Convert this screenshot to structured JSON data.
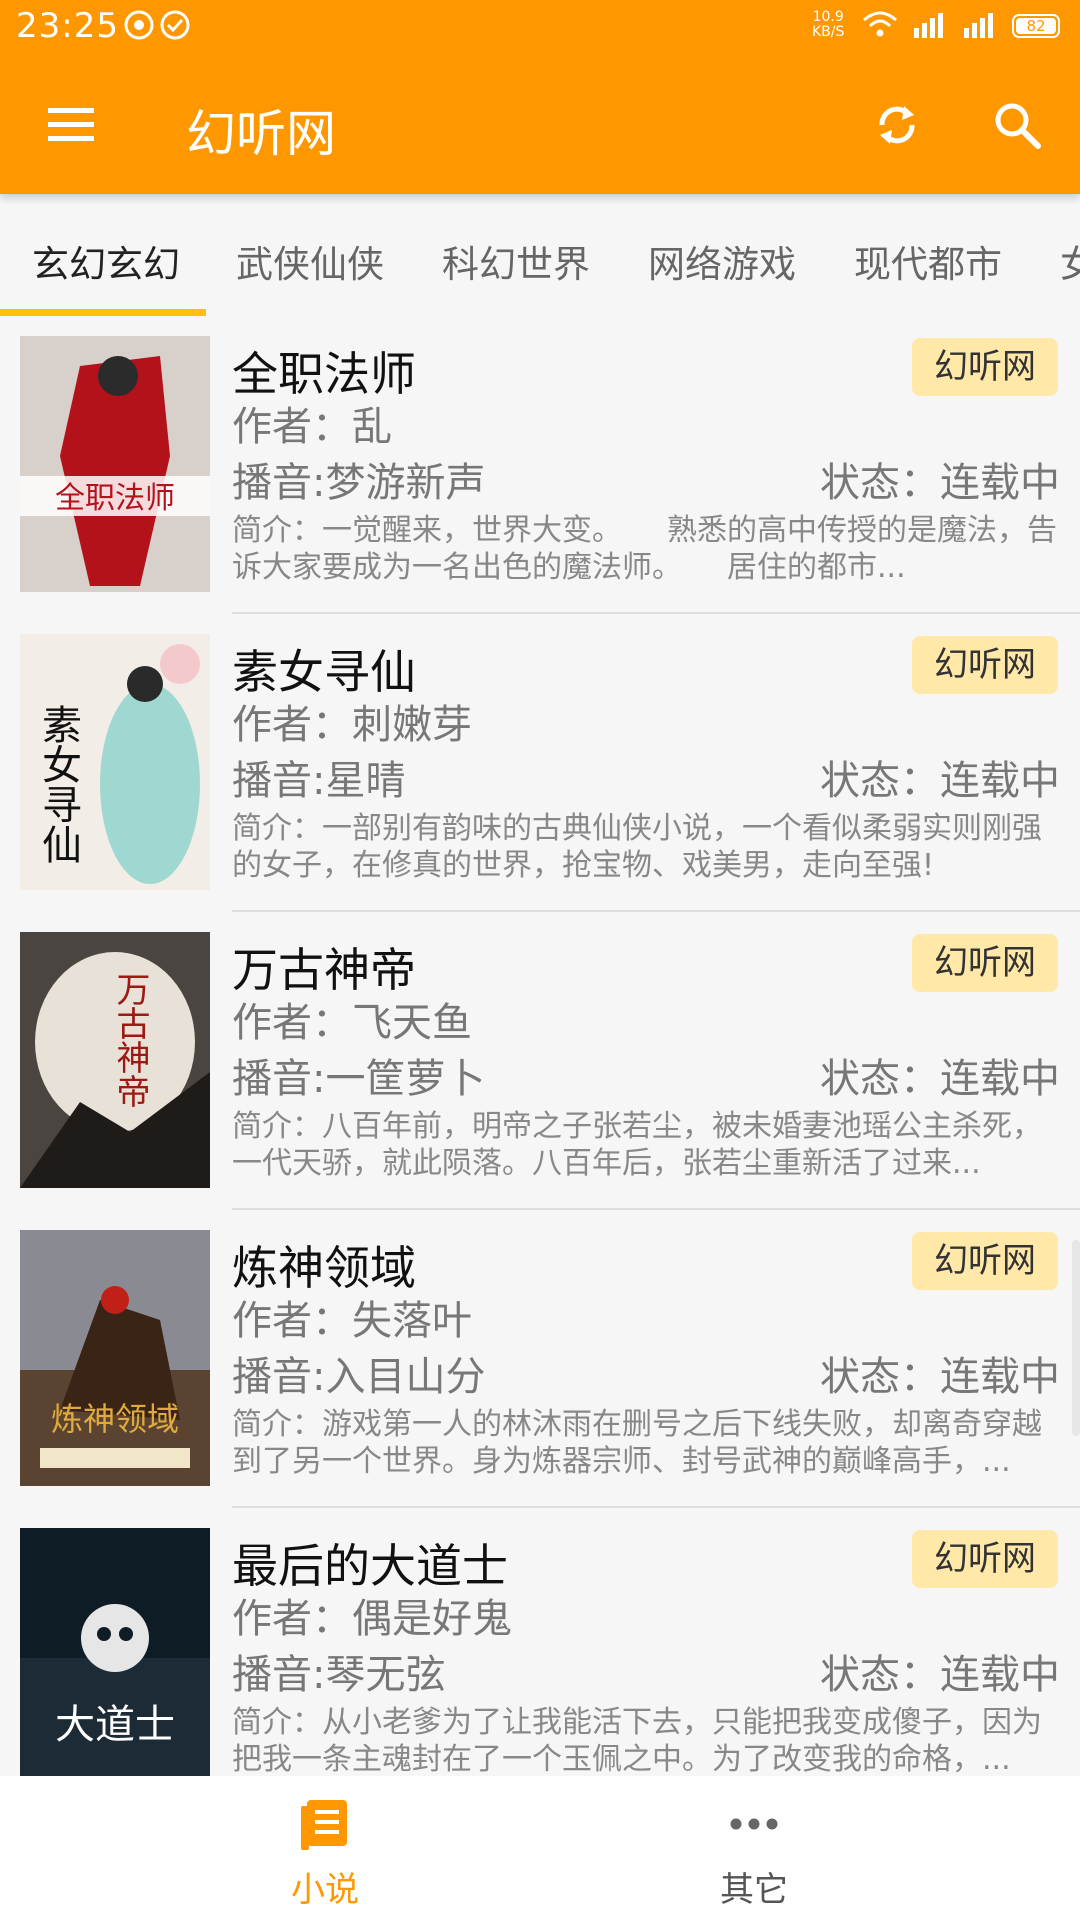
{
  "status_bar": {
    "time": "23:25",
    "net_speed_value": "10.9",
    "net_speed_unit": "KB/S",
    "battery": "82"
  },
  "toolbar": {
    "title": "幻听网"
  },
  "tabs": [
    {
      "label": "玄幻玄幻",
      "active": true
    },
    {
      "label": "武侠仙侠",
      "active": false
    },
    {
      "label": "科幻世界",
      "active": false
    },
    {
      "label": "网络游戏",
      "active": false
    },
    {
      "label": "现代都市",
      "active": false
    },
    {
      "label": "女",
      "active": false
    }
  ],
  "books": [
    {
      "title": "全职法师",
      "source": "幻听网",
      "author": "作者：乱",
      "narrator": "播音:梦游新声",
      "status": "状态：连载中",
      "summary": "简介：一觉醒来，世界大变。　　熟悉的高中传授的是魔法，告诉大家要成为一名出色的魔法师。　　居住的都市..."
    },
    {
      "title": "素女寻仙",
      "source": "幻听网",
      "author": "作者：刺嫩芽",
      "narrator": "播音:星晴",
      "status": "状态：连载中",
      "summary": "简介：一部别有韵味的古典仙侠小说，一个看似柔弱实则刚强的女子，在修真的世界，抢宝物、戏美男，走向至强!"
    },
    {
      "title": "万古神帝",
      "source": "幻听网",
      "author": "作者：飞天鱼",
      "narrator": "播音:一筐萝卜",
      "status": "状态：连载中",
      "summary": "简介：八百年前，明帝之子张若尘，被未婚妻池瑶公主杀死，一代天骄，就此陨落。八百年后，张若尘重新活了过来..."
    },
    {
      "title": "炼神领域",
      "source": "幻听网",
      "author": "作者：失落叶",
      "narrator": "播音:入目山分",
      "status": "状态：连载中",
      "summary": "简介：游戏第一人的林沐雨在删号之后下线失败，却离奇穿越到了另一个世界。身为炼器宗师、封号武神的巅峰高手，..."
    },
    {
      "title": "最后的大道士",
      "source": "幻听网",
      "author": "作者：偶是好鬼",
      "narrator": "播音:琴无弦",
      "status": "状态：连载中",
      "summary": "简介：从小老爹为了让我能活下去，只能把我变成傻子，因为把我一条主魂封在了一个玉佩之中。为了改变我的命格，..."
    }
  ],
  "covers": [
    {
      "text": "全职法师",
      "bg": "#c9c2bd",
      "accent": "#b3121b"
    },
    {
      "text": "素女寻仙",
      "bg": "#f1ece6",
      "accent": "#1b1b1b"
    },
    {
      "text": "万古神帝",
      "bg": "#2f2a26",
      "accent": "#9b1a12"
    },
    {
      "text": "炼神领域",
      "bg": "#3a2a1e",
      "accent": "#d8a23a"
    },
    {
      "text": "大道士",
      "bg": "#0d1a22",
      "accent": "#ffffff"
    }
  ],
  "bottom_nav": {
    "novel_label": "小说",
    "other_label": "其它"
  },
  "colors": {
    "primary": "#ff9800",
    "badge": "#ffe8a8",
    "indicator": "#ffc107"
  },
  "icons": [
    "menu-icon",
    "refresh-icon",
    "search-icon",
    "book-list-icon",
    "more-dots-icon",
    "wifi-icon",
    "signal-icon"
  ]
}
